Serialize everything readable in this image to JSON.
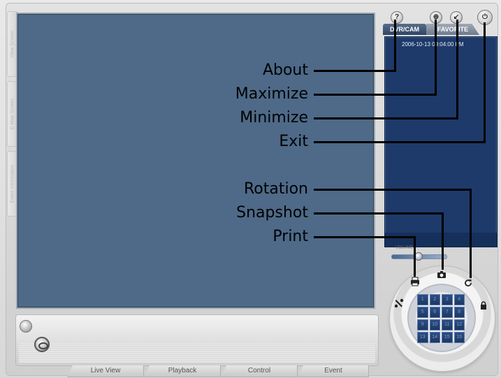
{
  "window": {
    "left_tabs": [
      "View Screen",
      "E-Map Screen",
      "Event Information"
    ]
  },
  "top_buttons": {
    "about": "?",
    "maximize": "⊕",
    "minimize": "↙",
    "exit": "⏻"
  },
  "right_panel": {
    "tabs": [
      "DVR/CAM",
      "FAVORITE"
    ],
    "timestamp": "2006-10-13 09:04:00 PM",
    "volume_label": "VOLUME"
  },
  "bottom_tabs": [
    "Live View",
    "Playback",
    "Control",
    "Event"
  ],
  "ptz": {
    "channels": [
      "1",
      "2",
      "3",
      "4",
      "5",
      "6",
      "7",
      "8",
      "9",
      "10",
      "11",
      "12",
      "13",
      "14",
      "15",
      "16"
    ],
    "icons": {
      "print": "print-icon",
      "snapshot": "camera-icon",
      "rotation": "rotate-icon",
      "tools": "wrench-icon",
      "lock": "lock-icon"
    }
  },
  "callouts": {
    "about": "About",
    "maximize": "Maximize",
    "minimize": "Minimize",
    "exit": "Exit",
    "rotation": "Rotation",
    "snapshot": "Snapshot",
    "print": "Print"
  }
}
